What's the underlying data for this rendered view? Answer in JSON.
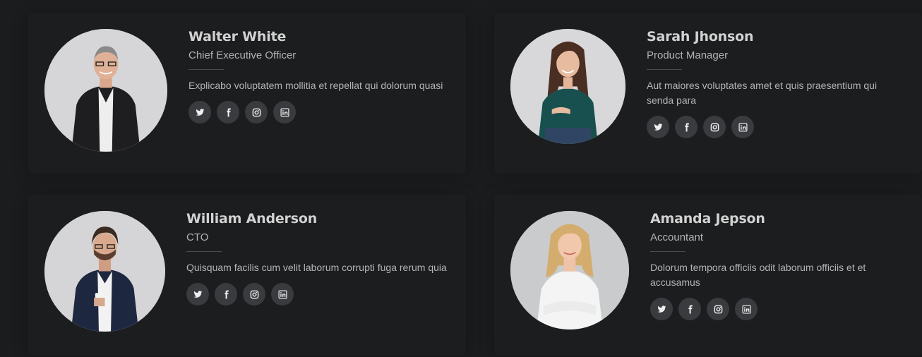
{
  "team": [
    {
      "name": "Walter White",
      "role": "Chief Executive Officer",
      "description": "Explicabo voluptatem mollitia et repellat qui dolorum quasi"
    },
    {
      "name": "Sarah Jhonson",
      "role": "Product Manager",
      "description": "Aut maiores voluptates amet et quis praesentium qui senda para"
    },
    {
      "name": "William Anderson",
      "role": "CTO",
      "description": "Quisquam facilis cum velit laborum corrupti fuga rerum quia"
    },
    {
      "name": "Amanda Jepson",
      "role": "Accountant",
      "description": "Dolorum tempora officiis odit laborum officiis et et accusamus"
    }
  ],
  "social_icons": [
    "twitter-icon",
    "facebook-icon",
    "instagram-icon",
    "linkedin-icon"
  ],
  "colors": {
    "background": "#1b1c1e",
    "name": "#d2d2d2",
    "text": "#b4b4b4",
    "social_bg": "#3a3b3e",
    "social_icon": "#f0f0f0"
  }
}
